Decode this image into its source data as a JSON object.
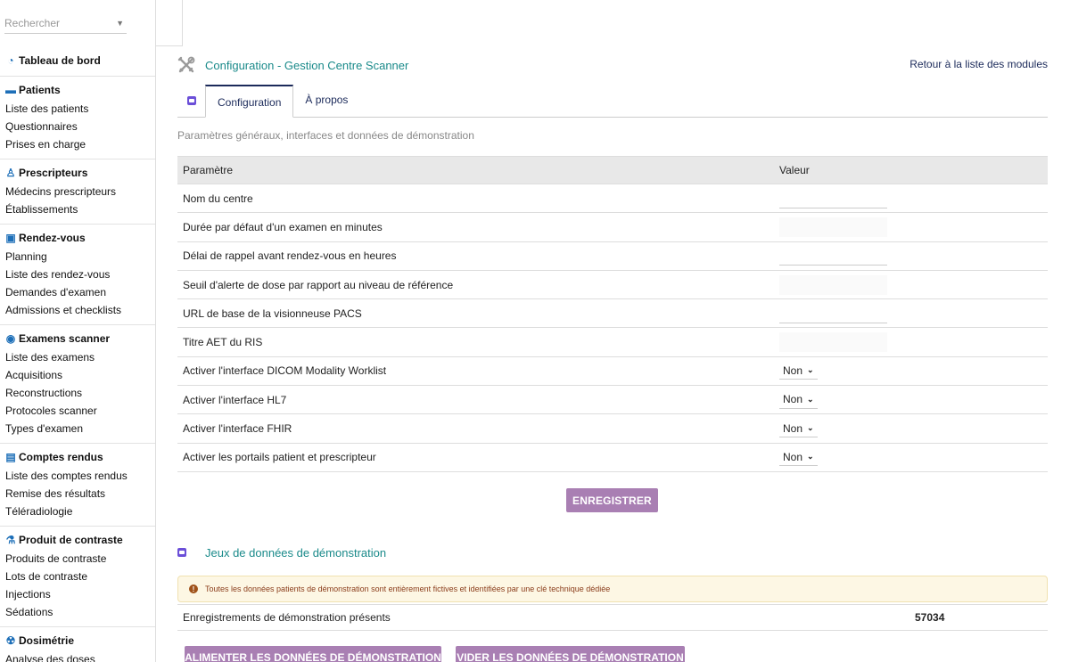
{
  "sidebar": {
    "search_placeholder": "Rechercher",
    "groups": [
      {
        "title": "Tableau de bord",
        "icon": "dashboard-icon",
        "items": []
      },
      {
        "title": "Patients",
        "icon": "bed-icon",
        "items": [
          "Liste des patients",
          "Questionnaires",
          "Prises en charge"
        ]
      },
      {
        "title": "Prescripteurs",
        "icon": "user-md-icon",
        "items": [
          "Médecins prescripteurs",
          "Établissements"
        ]
      },
      {
        "title": "Rendez-vous",
        "icon": "calendar-check-icon",
        "items": [
          "Planning",
          "Liste des rendez-vous",
          "Demandes d'examen",
          "Admissions et checklists"
        ]
      },
      {
        "title": "Examens scanner",
        "icon": "scanner-icon",
        "items": [
          "Liste des examens",
          "Acquisitions",
          "Reconstructions",
          "Protocoles scanner",
          "Types d'examen"
        ]
      },
      {
        "title": "Comptes rendus",
        "icon": "document-icon",
        "items": [
          "Liste des comptes rendus",
          "Remise des résultats",
          "Téléradiologie"
        ]
      },
      {
        "title": "Produit de contraste",
        "icon": "flask-icon",
        "items": [
          "Produits de contraste",
          "Lots de contraste",
          "Injections",
          "Sédations"
        ]
      },
      {
        "title": "Dosimétrie",
        "icon": "radiation-icon",
        "items": [
          "Analyse des doses"
        ]
      }
    ]
  },
  "header": {
    "title": "Configuration - Gestion Centre Scanner",
    "back_link": "Retour à la liste des modules"
  },
  "tabs": [
    {
      "label": "Configuration",
      "active": true
    },
    {
      "label": "À propos",
      "active": false
    }
  ],
  "subtitle": "Paramètres généraux, interfaces et données de démonstration",
  "table": {
    "col_param": "Paramètre",
    "col_value": "Valeur",
    "rows": [
      {
        "label": "Nom du centre",
        "type": "text",
        "value": ""
      },
      {
        "label": "Durée par défaut d'un examen en minutes",
        "type": "text",
        "value": ""
      },
      {
        "label": "Délai de rappel avant rendez-vous en heures",
        "type": "text",
        "value": ""
      },
      {
        "label": "Seuil d'alerte de dose par rapport au niveau de référence",
        "type": "text",
        "value": ""
      },
      {
        "label": "URL de base de la visionneuse PACS",
        "type": "text",
        "value": ""
      },
      {
        "label": "Titre AET du RIS",
        "type": "text",
        "value": ""
      },
      {
        "label": "Activer l'interface DICOM Modality Worklist",
        "type": "select",
        "value": "Non"
      },
      {
        "label": "Activer l'interface HL7",
        "type": "select",
        "value": "Non"
      },
      {
        "label": "Activer l'interface FHIR",
        "type": "select",
        "value": "Non"
      },
      {
        "label": "Activer les portails patient et prescripteur",
        "type": "select",
        "value": "Non"
      }
    ]
  },
  "save_label": "ENREGISTRER",
  "demo": {
    "title": "Jeux de données de démonstration",
    "alert": "Toutes les données patients de démonstration sont entièrement fictives et identifiées par une clé technique dédiée",
    "records_label": "Enregistrements de démonstration présents",
    "records_count": "57034",
    "feed_label": "ALIMENTER LES DONNÉES DE DÉMONSTRATION",
    "clear_label": "VIDER LES DONNÉES DE DÉMONSTRATION"
  },
  "colors": {
    "accent_teal": "#1a8a8a",
    "button_purple": "#a97fb3",
    "link_navy": "#1b2a5a",
    "icon_blue": "#1d6fb8"
  }
}
